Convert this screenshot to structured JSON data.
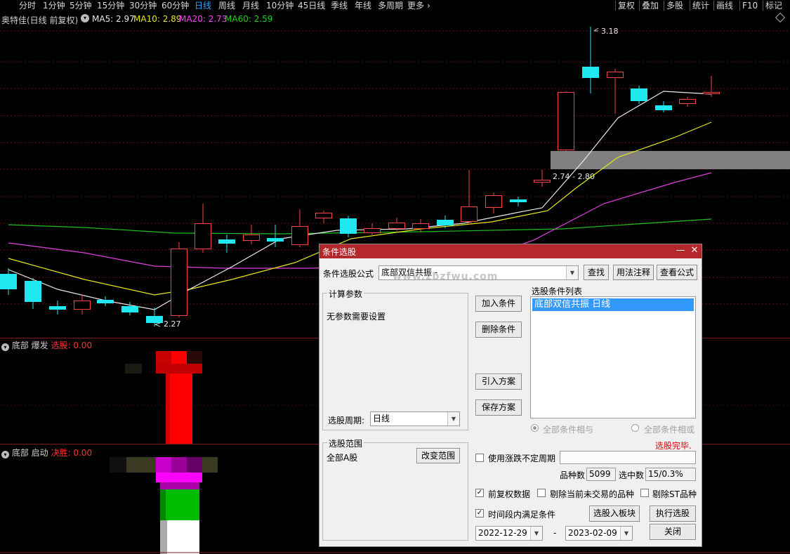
{
  "toolbar": {
    "periods": [
      "分时",
      "1分钟",
      "5分钟",
      "15分钟",
      "30分钟",
      "60分钟",
      "日线",
      "周线",
      "月线",
      "10分钟",
      "45日线",
      "季线",
      "年线",
      "多周期",
      "更多"
    ],
    "active_period": "日线",
    "more_arrow": "›",
    "right_buttons": [
      "复权",
      "叠加",
      "多股",
      "统计",
      "画线",
      "F10",
      "标记"
    ]
  },
  "chart": {
    "stock_title": "奥特佳(日线 前复权)",
    "ma": [
      {
        "label": "MA5: 2.97",
        "color": "#e8e8e8"
      },
      {
        "label": "MA10: 2.89",
        "color": "#e8e81a"
      },
      {
        "label": "MA20: 2.73",
        "color": "#ff40ff"
      },
      {
        "label": "MA60: 2.59",
        "color": "#20d020"
      }
    ],
    "high_label": "3.18",
    "low_label": "2.27",
    "zone_label": "2.74 - 2.80",
    "colors": {
      "up": "#ff4040",
      "down": "#20e8f0",
      "ma5": "#e8e8e8",
      "ma10": "#e8e81a",
      "ma20": "#e040e0",
      "ma60": "#20c020",
      "zone": "#808080",
      "grid": "#6a1010"
    }
  },
  "panel1": {
    "name": "底部 爆发",
    "tag": "选股",
    "value": "0.00"
  },
  "panel2": {
    "name": "底部 启动",
    "tag": "决胜",
    "value": "0.00"
  },
  "dialog": {
    "title": "条件选股",
    "minimize": "—",
    "close": "✕",
    "formula_label": "条件选股公式",
    "formula_value": "底部双信共振 -",
    "find_button": "查找",
    "usage_button": "用法注释",
    "view_button": "查看公式",
    "params_group": "计算参数",
    "params_text": "无参数需要设置",
    "period_label": "选股周期:",
    "period_value": "日线",
    "add_button": "加入条件",
    "delete_button": "删除条件",
    "import_button": "引入方案",
    "save_button": "保存方案",
    "cond_list_label": "选股条件列表",
    "cond_items": [
      "底部双信共振  日线"
    ],
    "radio_and": "全部条件相与",
    "radio_or": "全部条件相或",
    "status": "选股完毕.",
    "range_group": "选股范围",
    "range_value": "全部A股",
    "change_range_button": "改变范围",
    "unstable_period_label": "使用涨跌不定周期",
    "count_label": "品种数",
    "count_value": "5099",
    "selected_label": "选中数",
    "selected_value": "15/0.3%",
    "forward_adj_label": "前复权数据",
    "exclude_untraded_label": "剔除当前未交易的品种",
    "exclude_st_label": "剔除ST品种",
    "time_range_label": "时间段内满足条件",
    "to_block_button": "选股入板块",
    "execute_button": "执行选股",
    "date_from": "2022-12-29",
    "date_dash": "-",
    "date_to": "2023-02-09",
    "close_button": "关闭",
    "watermark": "www.zbzfwu.com"
  }
}
